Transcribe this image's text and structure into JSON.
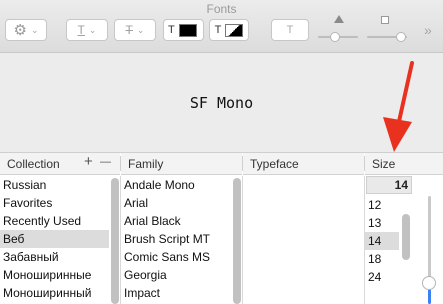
{
  "window": {
    "title": "Fonts"
  },
  "toolbar": {
    "text_style_icon": "T",
    "strike_icon": "T",
    "text_color_label": "T",
    "shadow_icon": "T"
  },
  "preview": {
    "text": "SF Mono"
  },
  "columns": {
    "collection": "Collection",
    "family": "Family",
    "typeface": "Typeface",
    "size": "Size"
  },
  "collection_controls": {
    "add": "+",
    "remove": "—"
  },
  "collections": [
    "Russian",
    "Favorites",
    "Recently Used",
    "Веб",
    "Забавный",
    "Моноширинные",
    "Моноширинный"
  ],
  "collection_selected_index": 3,
  "families": [
    "Andale Mono",
    "Arial",
    "Arial Black",
    "Brush Script MT",
    "Comic Sans MS",
    "Georgia",
    "Impact"
  ],
  "size": {
    "current": "14",
    "options": [
      "12",
      "13",
      "14",
      "18",
      "24"
    ],
    "selected_index": 2
  }
}
